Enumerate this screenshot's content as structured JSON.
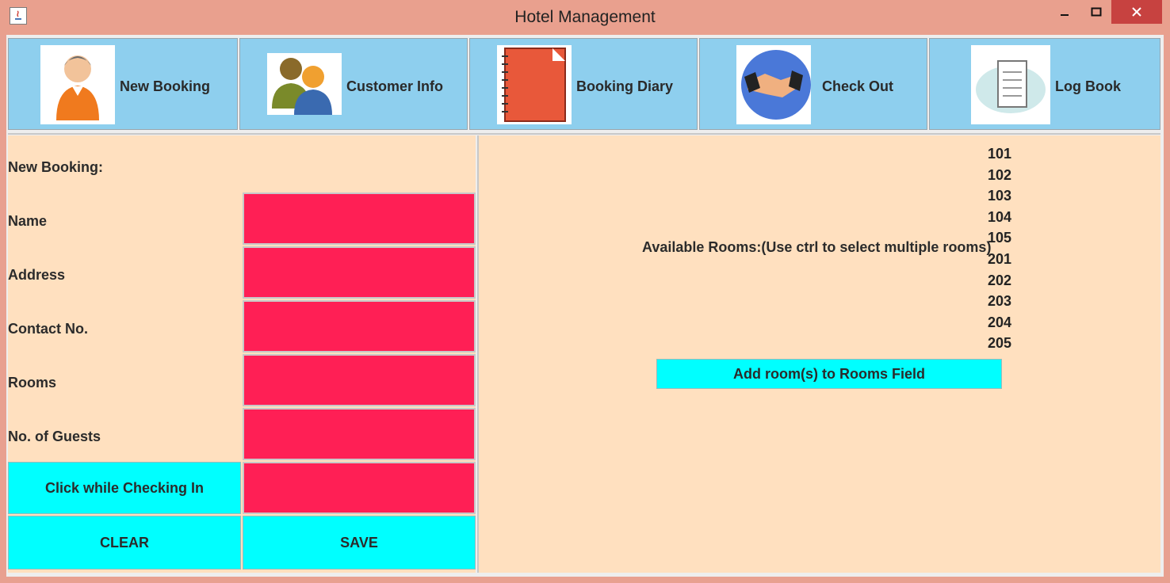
{
  "window": {
    "title": "Hotel Management"
  },
  "toolbar": {
    "buttons": [
      {
        "label": "New Booking",
        "icon": "person-icon"
      },
      {
        "label": "Customer Info",
        "icon": "users-icon"
      },
      {
        "label": "Booking Diary",
        "icon": "notebook-icon"
      },
      {
        "label": "Check Out",
        "icon": "handshake-icon"
      },
      {
        "label": "Log Book",
        "icon": "logbook-icon"
      }
    ]
  },
  "form": {
    "heading": "New Booking:",
    "fields": [
      {
        "label": "Name",
        "value": ""
      },
      {
        "label": "Address",
        "value": ""
      },
      {
        "label": "Contact No.",
        "value": ""
      },
      {
        "label": "Rooms",
        "value": ""
      },
      {
        "label": "No. of Guests",
        "value": ""
      }
    ],
    "checkin_button": "Click while Checking In",
    "checkin_value": "",
    "clear_button": "CLEAR",
    "save_button": "SAVE"
  },
  "rooms": {
    "label": "Available Rooms:(Use ctrl to select multiple rooms)",
    "items": [
      "101",
      "102",
      "103",
      "104",
      "105",
      "201",
      "202",
      "203",
      "204",
      "205"
    ],
    "add_button": "Add room(s) to Rooms Field"
  },
  "colors": {
    "titlebar": "#e9a08e",
    "toolbar_button": "#8ecfee",
    "panel_bg": "#ffe0bf",
    "field_bg": "#ff1f55",
    "action_button": "#00ffff",
    "close_button": "#c74240"
  }
}
